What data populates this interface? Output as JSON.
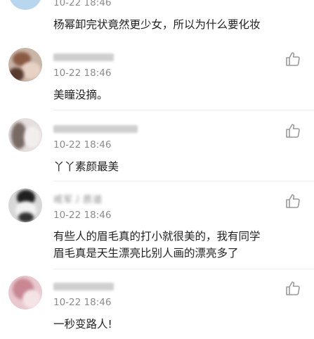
{
  "top_comment": {
    "time": "10-22 18:46",
    "text": "杨幂卸完状竟然更少女，所以为什么要化妆"
  },
  "comments": [
    {
      "time": "10-22 18:46",
      "text": "美瞳没摘。"
    },
    {
      "time": "10-22 18:46",
      "text": "丫丫素颜最美"
    },
    {
      "time": "10-22 18:46",
      "name_partial": "戒军丿质道",
      "text_line1": "有些人的眉毛真的打小就很美的，我有同学",
      "text_line2": "眉毛真是天生漂亮比别人画的漂亮多了"
    },
    {
      "time": "10-22 18:46",
      "text": "一秒变路人!"
    }
  ],
  "icons": {
    "like": "thumbs-up-icon"
  },
  "colors": {
    "time": "#8c8c8c",
    "text": "#222222",
    "icon": "#9a9a9a"
  }
}
